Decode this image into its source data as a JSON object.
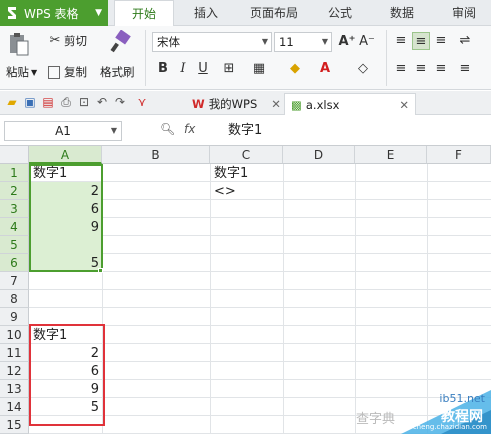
{
  "app": {
    "name": "WPS 表格",
    "color": "#4c9e2f"
  },
  "menus": [
    "开始",
    "插入",
    "页面布局",
    "公式",
    "数据",
    "审阅"
  ],
  "ribbon": {
    "paste": "粘贴",
    "cut": "剪切",
    "copy": "复制",
    "format_painter": "格式刷",
    "font_name": "宋体",
    "font_size": "11",
    "bold": "B",
    "italic": "I",
    "underline": "U"
  },
  "doc_tabs": [
    {
      "label": "我的WPS"
    },
    {
      "label": "a.xlsx"
    }
  ],
  "formula_bar": {
    "name_box": "A1",
    "fx": "fx",
    "content": "数字1"
  },
  "columns": [
    "A",
    "B",
    "C",
    "D",
    "E",
    "F"
  ],
  "rows": [
    "1",
    "2",
    "3",
    "4",
    "5",
    "6",
    "7",
    "8",
    "9",
    "10",
    "11",
    "12",
    "13",
    "14",
    "15"
  ],
  "cells": {
    "A1": "数字1",
    "A2": "2",
    "A3": "6",
    "A4": "9",
    "A6": "5",
    "C1": "数字1",
    "C2": "<>",
    "A10": "数字1",
    "A11": "2",
    "A12": "6",
    "A13": "9",
    "A14": "5"
  },
  "watermark": {
    "site": "ib51.net",
    "brand": "教程网",
    "url": "jiaocheng.chazidian.com",
    "text2": "查字典"
  }
}
